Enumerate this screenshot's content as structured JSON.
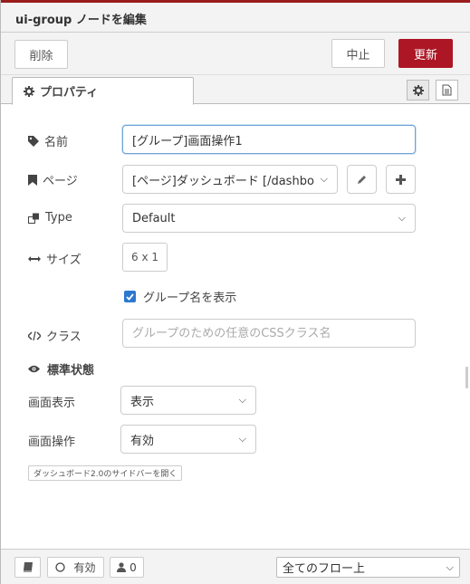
{
  "header": {
    "title": "ui-group ノードを編集"
  },
  "toolbar": {
    "delete_label": "削除",
    "cancel_label": "中止",
    "update_label": "更新"
  },
  "tabs": {
    "properties_label": "プロパティ",
    "icons": [
      "gear-icon",
      "description-icon"
    ]
  },
  "form": {
    "name": {
      "label": "名前",
      "value": "[グループ]画面操作1"
    },
    "page": {
      "label": "ページ",
      "value": "[ページ]ダッシュボード [/dashbo"
    },
    "type": {
      "label": "Type",
      "value": "Default"
    },
    "size": {
      "label": "サイズ",
      "value": "6 x 1"
    },
    "show_name": {
      "label": "グループ名を表示",
      "checked": true
    },
    "class": {
      "label": "クラス",
      "placeholder": "グループのための任意のCSSクラス名"
    },
    "default_state": {
      "label": "標準状態"
    },
    "display": {
      "label": "画面表示",
      "value": "表示"
    },
    "operation": {
      "label": "画面操作",
      "value": "有効"
    },
    "sidebar_button": "ダッシュボード2.0のサイドバーを開く"
  },
  "footer": {
    "enabled_label": "有効",
    "count": "0",
    "flow_select": "全てのフロー上"
  },
  "colors": {
    "accent": "#ad1625",
    "checkbox": "#2d78cf",
    "focus": "#6fa3d6"
  }
}
